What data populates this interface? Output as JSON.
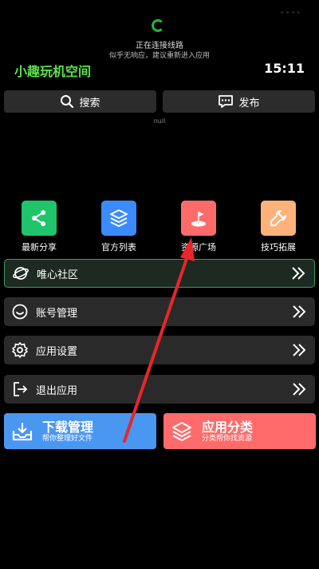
{
  "connection": {
    "title": "正在连接线路",
    "subtitle": "似乎无响应，建议重新进入应用"
  },
  "header": {
    "app_title": "小趣玩机空间",
    "time": "15:11"
  },
  "top_buttons": {
    "search": "搜索",
    "publish": "发布"
  },
  "null_text": "null",
  "tiles": [
    {
      "label": "最新分享",
      "color": "#1fc46b",
      "icon": "share-icon"
    },
    {
      "label": "官方列表",
      "color": "#3b8bff",
      "icon": "layers-icon"
    },
    {
      "label": "资源广场",
      "color": "#ff6b6b",
      "icon": "flag-icon"
    },
    {
      "label": "技巧拓展",
      "color": "#ffb27a",
      "icon": "wrench-icon"
    }
  ],
  "menu_rows": [
    {
      "label": "唯心社区",
      "icon": "planet-icon"
    },
    {
      "label": "账号管理",
      "icon": "smiley-icon"
    },
    {
      "label": "应用设置",
      "icon": "gear-icon"
    },
    {
      "label": "退出应用",
      "icon": "exit-icon"
    }
  ],
  "bottom_buttons": {
    "download": {
      "title": "下载管理",
      "subtitle": "帮你整理好文件",
      "color": "#4a97f2",
      "icon": "download-tray-icon"
    },
    "category": {
      "title": "应用分类",
      "subtitle": "分类帮你找资源",
      "color": "#ff6b6b",
      "icon": "stack-icon"
    }
  },
  "annotation_color": "#e8262b"
}
